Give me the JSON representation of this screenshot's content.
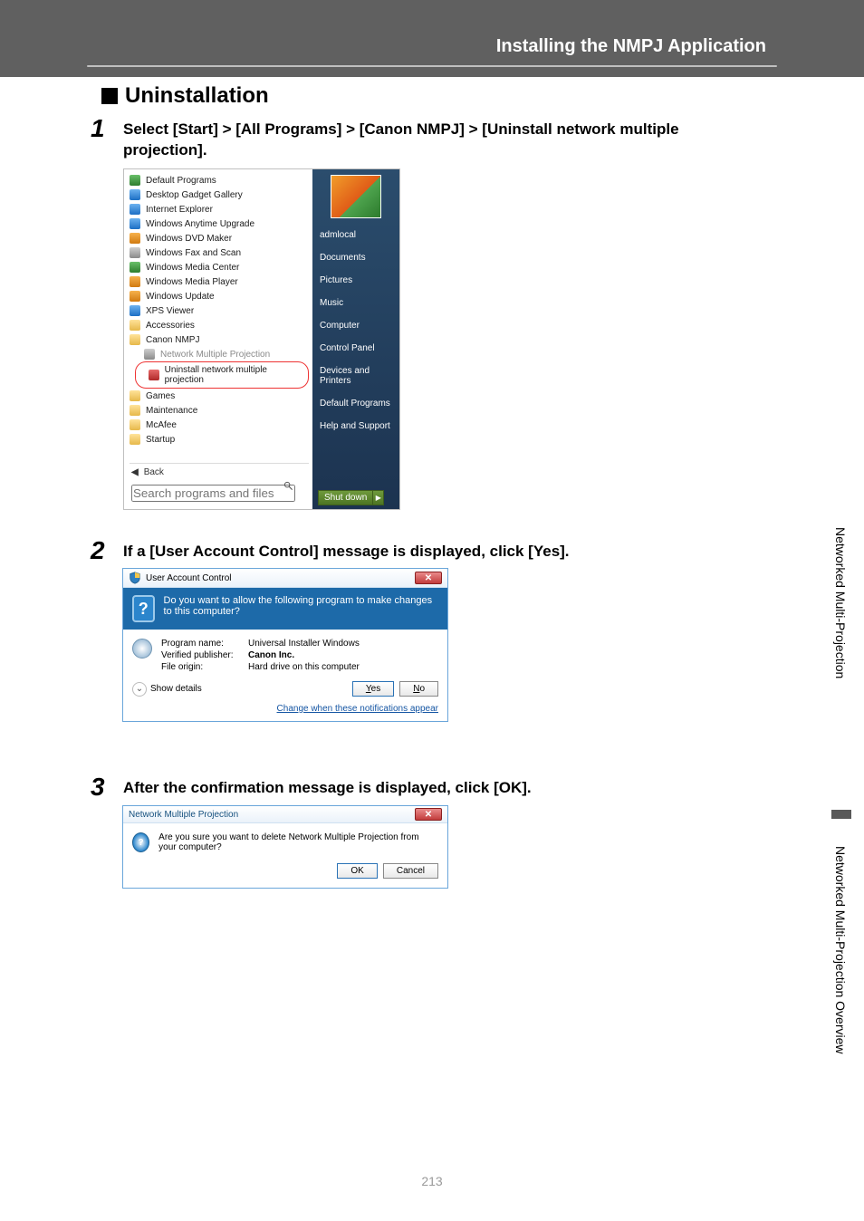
{
  "header": {
    "title": "Installing the NMPJ Application"
  },
  "section": {
    "title": "Uninstallation"
  },
  "steps": {
    "s1": {
      "num": "1",
      "text": "Select [Start] > [All Programs] > [Canon NMPJ] > [Uninstall network multiple projection]."
    },
    "s2": {
      "num": "2",
      "text": "If a [User Account Control] message is displayed, click [Yes]."
    },
    "s3": {
      "num": "3",
      "text": "After the confirmation message is displayed, click [OK]."
    }
  },
  "startmenu": {
    "items": [
      "Default Programs",
      "Desktop Gadget Gallery",
      "Internet Explorer",
      "Windows Anytime Upgrade",
      "Windows DVD Maker",
      "Windows Fax and Scan",
      "Windows Media Center",
      "Windows Media Player",
      "Windows Update",
      "XPS Viewer",
      "Accessories",
      "Canon NMPJ",
      "Network Multiple Projection",
      "Uninstall network multiple projection",
      "Games",
      "Maintenance",
      "McAfee",
      "Startup"
    ],
    "back": "Back",
    "search_placeholder": "Search programs and files",
    "right": {
      "user": "admlocal",
      "links": [
        "Documents",
        "Pictures",
        "Music",
        "Computer",
        "Control Panel",
        "Devices and Printers",
        "Default Programs",
        "Help and Support"
      ],
      "shutdown": "Shut down"
    }
  },
  "uac": {
    "title": "User Account Control",
    "prompt": "Do you want to allow the following program to make changes to this computer?",
    "labels": {
      "program": "Program name:",
      "publisher": "Verified publisher:",
      "origin": "File origin:"
    },
    "values": {
      "program": "Universal Installer Windows",
      "publisher": "Canon Inc.",
      "origin": "Hard drive on this computer"
    },
    "show_details": "Show details",
    "yes_plain": "es",
    "yes_ul": "Y",
    "no_plain": "o",
    "no_ul": "N",
    "link": "Change when these notifications appear"
  },
  "confirm": {
    "title": "Network Multiple Projection",
    "msg": "Are you sure you want to delete Network Multiple Projection from your computer?",
    "ok": "OK",
    "cancel": "Cancel"
  },
  "sidetabs": {
    "top": "Networked Multi-Projection",
    "bottom": "Networked Multi-Projection Overview"
  },
  "page_number": "213"
}
